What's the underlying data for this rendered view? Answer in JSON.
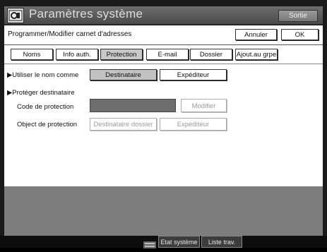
{
  "header": {
    "title": "Paramètres système",
    "exit_label": "Sortie"
  },
  "top_bar": {
    "breadcrumb": "Programmer/Modifier carnet d'adresses",
    "cancel_label": "Annuler",
    "ok_label": "OK"
  },
  "tabs": [
    {
      "label": "Noms"
    },
    {
      "label": "Info auth."
    },
    {
      "label": "Protection"
    },
    {
      "label": "E-mail"
    },
    {
      "label": "Dossier"
    },
    {
      "label": "Ajout.au grpe"
    }
  ],
  "use_name_as": {
    "label": "▶Utiliser le nom comme",
    "options": [
      "Destinataire",
      "Expéditeur"
    ],
    "selected": "Destinataire"
  },
  "protect": {
    "section_label": "▶Protéger destinataire",
    "code_label": "Code de protection",
    "code_value": "",
    "modify_label": "Modifier",
    "object_label": "Object de protection",
    "object_options": [
      "Destinataire dossier",
      "Expéditeur"
    ]
  },
  "status_bar": {
    "system_state_label": "Etat système",
    "job_list_label": "Liste trav."
  }
}
